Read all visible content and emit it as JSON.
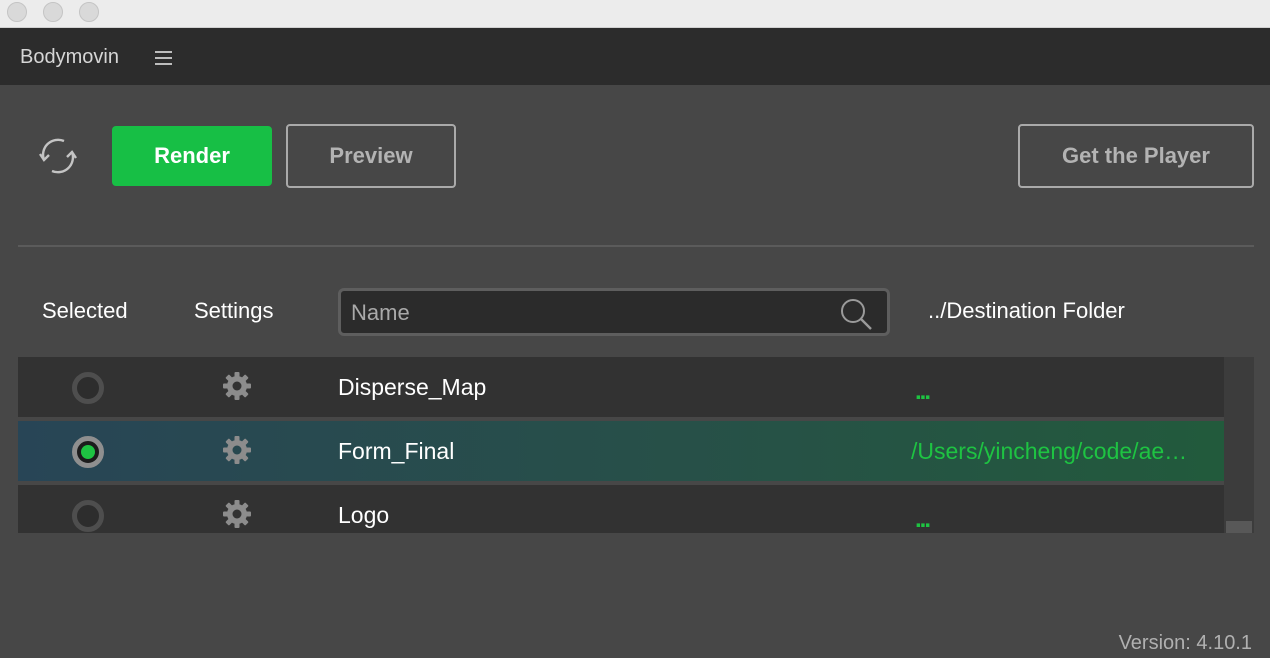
{
  "panel": {
    "title": "Bodymovin"
  },
  "toolbar": {
    "render_label": "Render",
    "preview_label": "Preview",
    "player_label": "Get the Player"
  },
  "columns": {
    "selected": "Selected",
    "settings": "Settings",
    "search_placeholder": "Name",
    "destination": "../Destination Folder"
  },
  "rows": [
    {
      "name": "Disperse_Map",
      "selected": false,
      "destination": "..."
    },
    {
      "name": "Form_Final",
      "selected": true,
      "destination": "/Users/yincheng/code/ae…"
    },
    {
      "name": "Logo",
      "selected": false,
      "destination": "..."
    }
  ],
  "footer": {
    "version": "Version: 4.10.1"
  },
  "colors": {
    "accent_green": "#17bf45",
    "background": "#474747",
    "header": "#2c2c2c",
    "selected_row": "#275048"
  },
  "icons": [
    "refresh-icon",
    "menu-icon",
    "search-icon",
    "gear-icon",
    "radio-icon"
  ]
}
